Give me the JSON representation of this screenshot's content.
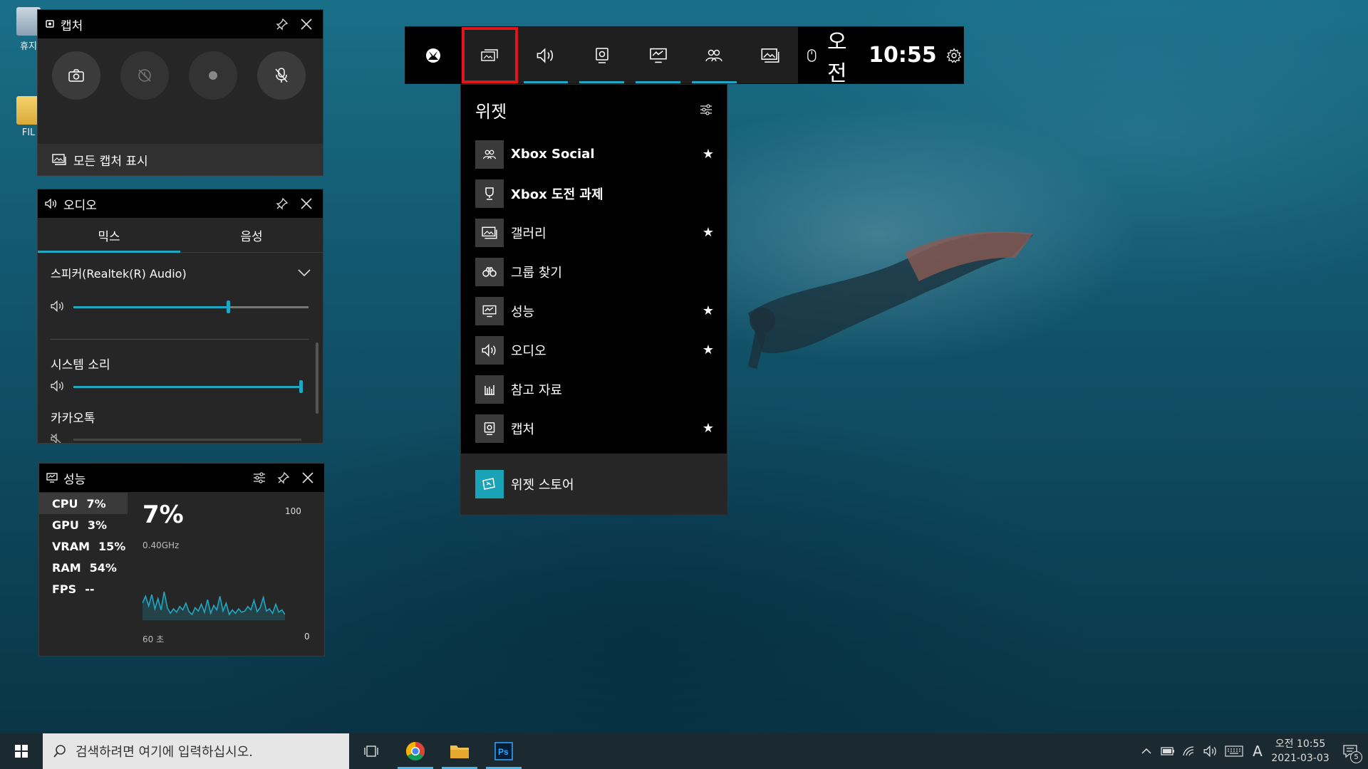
{
  "desktop": {
    "icons": [
      {
        "label": "휴지",
        "icon": "recycle-bin-icon"
      },
      {
        "label": "FIL",
        "icon": "folder-icon"
      }
    ]
  },
  "capture_widget": {
    "title": "캡처",
    "buttons": [
      "screenshot-button",
      "record-last-button",
      "record-button",
      "mic-toggle-button"
    ],
    "footer_label": "모든 캡처 표시"
  },
  "audio_widget": {
    "title": "오디오",
    "tabs": [
      "믹스",
      "음성"
    ],
    "device": "스피커(Realtek(R) Audio)",
    "master_volume": 0.66,
    "apps": [
      {
        "label": "시스템 소리",
        "volume": 1.0
      },
      {
        "label": "카카오톡",
        "volume": 0.0,
        "muted": true
      }
    ]
  },
  "perf_widget": {
    "title": "성능",
    "metrics": [
      {
        "label": "CPU",
        "value": "7%"
      },
      {
        "label": "GPU",
        "value": "3%"
      },
      {
        "label": "VRAM",
        "value": "15%"
      },
      {
        "label": "RAM",
        "value": "54%"
      },
      {
        "label": "FPS",
        "value": "--"
      }
    ],
    "big_value": "7%",
    "sub_value": "0.40GHz",
    "y_max": "100",
    "y_min": "0",
    "x_label": "60 초",
    "graph": [
      0.3,
      0.42,
      0.25,
      0.45,
      0.2,
      0.38,
      0.18,
      0.5,
      0.22,
      0.12,
      0.2,
      0.14,
      0.24,
      0.18,
      0.3,
      0.15,
      0.1,
      0.22,
      0.16,
      0.28,
      0.14,
      0.36,
      0.12,
      0.26,
      0.18,
      0.42,
      0.16,
      0.3,
      0.1,
      0.18,
      0.12,
      0.2,
      0.14,
      0.16,
      0.24,
      0.18,
      0.35,
      0.15,
      0.22,
      0.4,
      0.16,
      0.2,
      0.12,
      0.28,
      0.14,
      0.18,
      0.1
    ]
  },
  "game_bar": {
    "buttons": [
      "xbox-icon",
      "widget-menu-icon",
      "audio-icon",
      "capture-icon",
      "performance-icon",
      "social-icon",
      "gallery-icon"
    ],
    "time_prefix": "오전",
    "time": "10:55"
  },
  "widget_menu": {
    "title": "위젯",
    "items": [
      {
        "label": "Xbox Social",
        "icon": "social-icon",
        "fav": true,
        "bold": true
      },
      {
        "label": "Xbox 도전 과제",
        "icon": "trophy-icon",
        "fav": false,
        "bold": true
      },
      {
        "label": "갤러리",
        "icon": "gallery-icon",
        "fav": true
      },
      {
        "label": "그룹 찾기",
        "icon": "binoculars-icon",
        "fav": false
      },
      {
        "label": "성능",
        "icon": "performance-icon",
        "fav": true
      },
      {
        "label": "오디오",
        "icon": "audio-icon",
        "fav": true
      },
      {
        "label": "참고 자료",
        "icon": "resources-icon",
        "fav": false
      },
      {
        "label": "캡처",
        "icon": "capture-icon",
        "fav": true
      }
    ],
    "store_label": "위젯 스토어"
  },
  "taskbar": {
    "search_placeholder": "검색하려면 여기에 입력하십시오.",
    "clock_time": "오전 10:55",
    "clock_date": "2021-03-03",
    "notification_count": "5",
    "ime_label": "A"
  }
}
